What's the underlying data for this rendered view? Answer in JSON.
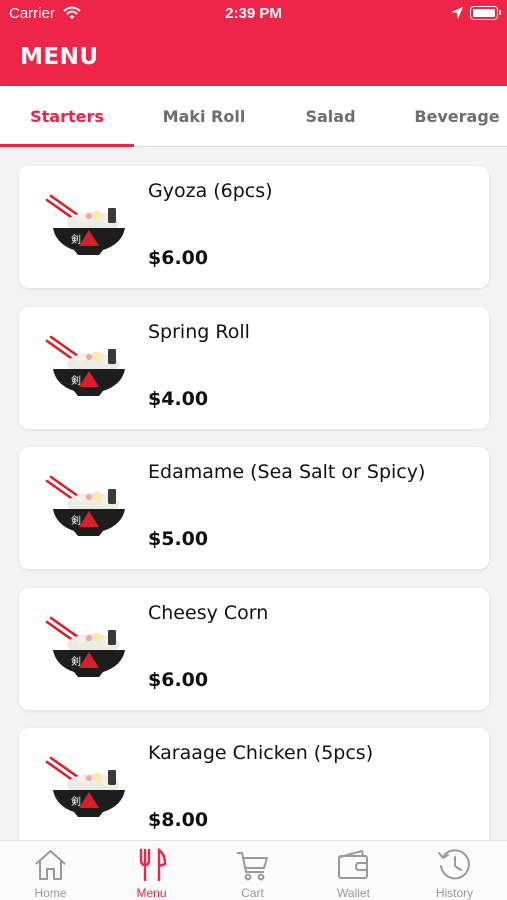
{
  "status_bar": {
    "carrier": "Carrier",
    "time": "2:39 PM"
  },
  "header": {
    "title": "MENU"
  },
  "tabs": [
    {
      "label": "Starters",
      "active": true
    },
    {
      "label": "Maki Roll",
      "active": false
    },
    {
      "label": "Salad",
      "active": false
    },
    {
      "label": "Beverage",
      "active": false
    }
  ],
  "items": [
    {
      "name": "Gyoza (6pcs)",
      "price": "$6.00",
      "icon": "ramen-bowl-icon"
    },
    {
      "name": "Spring Roll",
      "price": "$4.00",
      "icon": "ramen-bowl-icon"
    },
    {
      "name": "Edamame (Sea Salt or Spicy)",
      "price": "$5.00",
      "icon": "ramen-bowl-icon"
    },
    {
      "name": "Cheesy Corn",
      "price": "$6.00",
      "icon": "ramen-bowl-icon"
    },
    {
      "name": "Karaage Chicken (5pcs)",
      "price": "$8.00",
      "icon": "ramen-bowl-icon"
    }
  ],
  "tab_bar": [
    {
      "label": "Home",
      "icon": "home-icon",
      "active": false
    },
    {
      "label": "Menu",
      "icon": "fork-icon",
      "active": true
    },
    {
      "label": "Cart",
      "icon": "cart-icon",
      "active": false
    },
    {
      "label": "Wallet",
      "icon": "wallet-icon",
      "active": false
    },
    {
      "label": "History",
      "icon": "history-icon",
      "active": false
    }
  ],
  "colors": {
    "accent": "#ef2449",
    "inactive": "#9a9a9a",
    "background": "#f3f3f3"
  }
}
